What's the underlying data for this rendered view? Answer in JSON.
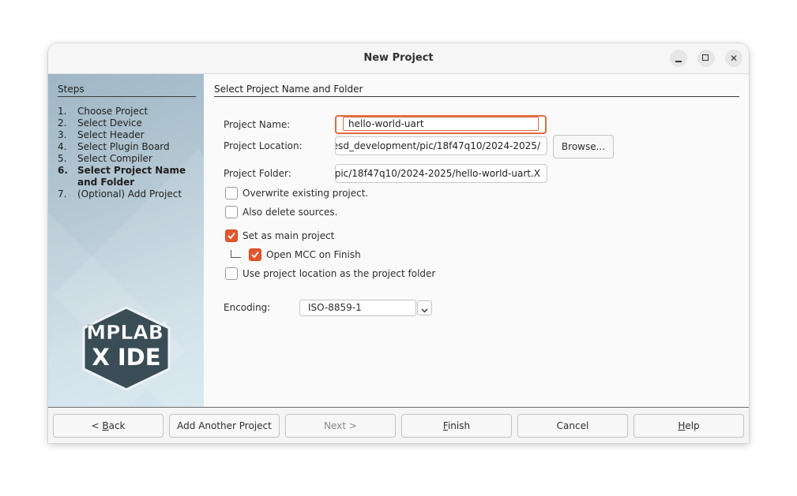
{
  "window": {
    "title": "New Project",
    "controls": [
      "minimize-icon",
      "maximize-icon",
      "close-icon"
    ],
    "close_glyph": "✕"
  },
  "sidebar": {
    "title": "Steps",
    "steps": [
      {
        "num": "1.",
        "label": "Choose Project"
      },
      {
        "num": "2.",
        "label": "Select Device"
      },
      {
        "num": "3.",
        "label": "Select Header"
      },
      {
        "num": "4.",
        "label": "Select Plugin Board"
      },
      {
        "num": "5.",
        "label": "Select Compiler"
      },
      {
        "num": "6.",
        "label": "Select Project Name and Folder",
        "active": true
      },
      {
        "num": "7.",
        "label": "(Optional) Add Project"
      }
    ],
    "logo": {
      "line1": "MPLAB",
      "line2": "X IDE",
      "mark": "®"
    }
  },
  "content": {
    "title": "Select Project Name and Folder",
    "project_name": {
      "label": "Project Name:",
      "value": "hello-world-uart"
    },
    "project_location": {
      "label": "Project Location:",
      "value": "esd_development/pic/18f47q10/2024-2025/"
    },
    "browse_label": "Browse...",
    "project_folder": {
      "label": "Project Folder:",
      "value": "pic/18f47q10/2024-2025/hello-world-uart.X"
    },
    "checkboxes": {
      "overwrite": {
        "label": "Overwrite existing project.",
        "checked": false
      },
      "delete_sources": {
        "label": "Also delete sources.",
        "checked": false
      },
      "main_project": {
        "label": "Set as main project",
        "checked": true
      },
      "open_mcc": {
        "label": "Open MCC on Finish",
        "checked": true
      },
      "use_location": {
        "label": "Use project location as the project folder",
        "checked": false
      }
    },
    "encoding": {
      "label": "Encoding:",
      "value": "ISO-8859-1"
    }
  },
  "footer": {
    "back": {
      "prefix": "< ",
      "mnemonic": "B",
      "rest": "ack"
    },
    "add_another": "Add Another Project",
    "next": "Next >",
    "finish": {
      "mnemonic": "F",
      "rest": "inish"
    },
    "cancel": "Cancel",
    "help": {
      "mnemonic": "H",
      "rest": "elp"
    }
  },
  "colors": {
    "accent": "#e2562c",
    "focus_border": "#e26b3c",
    "sidebar_top": "#9fb6c4",
    "sidebar_bottom": "#d7e7f0"
  }
}
